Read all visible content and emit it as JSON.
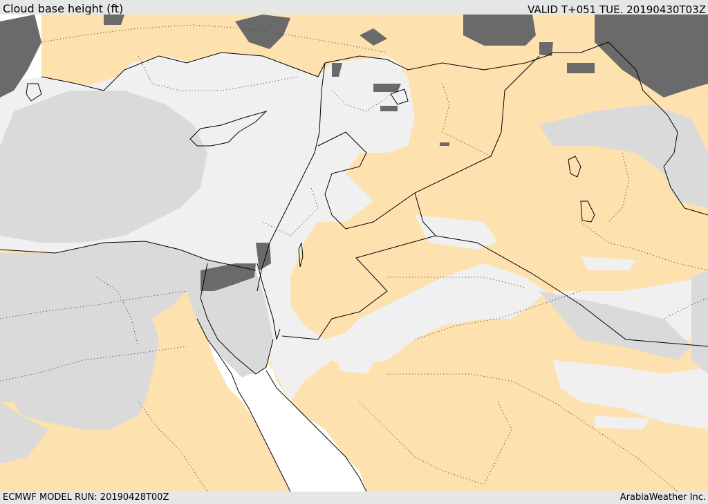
{
  "header": {
    "title": "Cloud base height (ft)",
    "valid": "VALID T+051 TUE. 20190430T03Z"
  },
  "footer": {
    "model_run": "ECMWF MODEL RUN: 20190428T00Z",
    "credit": "ArabiaWeather Inc."
  },
  "map": {
    "colors": {
      "sea": "#ffffff",
      "clear_land": "#fde1ae",
      "cloud_high": "#f0f0f0",
      "cloud_mid": "#dadada",
      "cloud_low": "#6a6a6a",
      "boundary": "#000000"
    },
    "icons": [
      "coastline",
      "country-border",
      "province-border"
    ]
  }
}
